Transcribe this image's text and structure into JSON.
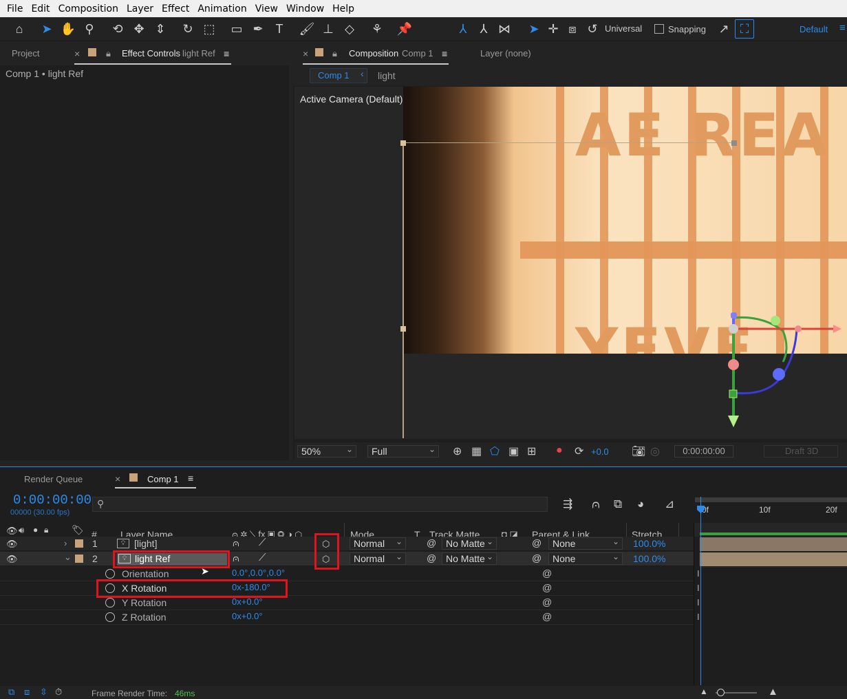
{
  "menu": [
    "File",
    "Edit",
    "Composition",
    "Layer",
    "Effect",
    "Animation",
    "View",
    "Window",
    "Help"
  ],
  "toolbar": {
    "universal_label": "Universal",
    "snapping_label": "Snapping",
    "workspace_label": "Default"
  },
  "left_panel": {
    "tab_project": "Project",
    "tab_effect_controls": "Effect Controls",
    "tab_effect_controls_layer": "light Ref",
    "breadcrumb": "Comp 1 • light Ref"
  },
  "comp_panel": {
    "tab_composition": "Composition",
    "tab_comp_name": "Comp 1",
    "tab_layer": "Layer (none)",
    "flow_comp": "Comp 1",
    "flow_light": "light",
    "camera_label": "Active Camera (Default)",
    "viewer_text_top": "AE REA",
    "viewer_text_bottom": "YEVE",
    "zoom": "50%",
    "resolution": "Full",
    "exposure": "+0.0",
    "timecode": "0:00:00:00",
    "renderer": "Draft 3D"
  },
  "timeline": {
    "tab_render_queue": "Render Queue",
    "tab_comp": "Comp 1",
    "current_time": "0:00:00:00",
    "frame_info": "00000 (30.00 fps)",
    "search_placeholder": "",
    "headers": {
      "hash": "#",
      "layer_name": "Layer Name",
      "mode": "Mode",
      "t": "T",
      "track_matte": "Track Matte",
      "parent_link": "Parent & Link",
      "stretch": "Stretch"
    },
    "ruler": [
      "0f",
      "10f",
      "20f"
    ],
    "layers": [
      {
        "num": "1",
        "name": "[light]",
        "mode": "Normal",
        "matte": "No Matte",
        "parent": "None",
        "stretch": "100.0%"
      },
      {
        "num": "2",
        "name": "light Ref",
        "mode": "Normal",
        "matte": "No Matte",
        "parent": "None",
        "stretch": "100.0%"
      }
    ],
    "properties": [
      {
        "name": "Orientation",
        "value": "0.0°,0.0°,0.0°"
      },
      {
        "name": "X Rotation",
        "value": "0x-180.0°"
      },
      {
        "name": "Y Rotation",
        "value": "0x+0.0°"
      },
      {
        "name": "Z Rotation",
        "value": "0x+0.0°"
      }
    ],
    "frame_render_label": "Frame Render Time:",
    "frame_render_value": "46ms"
  },
  "colors": {
    "accent": "#2d8ceb",
    "highlight_box": "#e0141e",
    "label_swatch": "#c8a27a",
    "track_green": "#3aa23a"
  }
}
